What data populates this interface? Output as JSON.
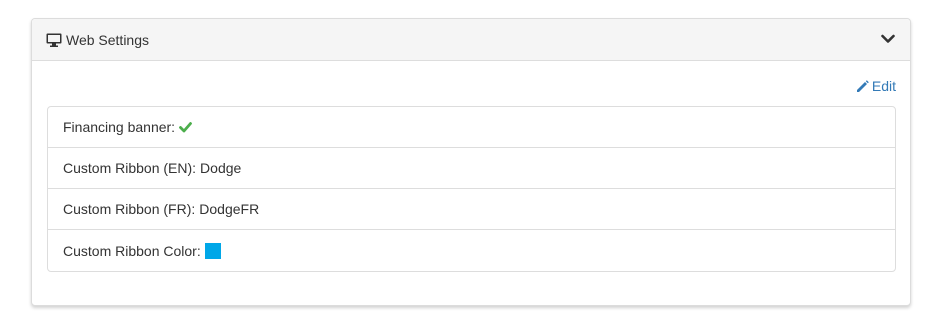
{
  "panel": {
    "title": "Web Settings",
    "title_icon": "monitor-icon",
    "toggle_icon": "chevron-down-icon",
    "edit_label": "Edit",
    "edit_icon": "pencil-icon"
  },
  "settings": [
    {
      "label": "Financing banner:",
      "value": "",
      "value_type": "check-icon"
    },
    {
      "label": "Custom Ribbon (EN):",
      "value": "Dodge",
      "value_type": "text"
    },
    {
      "label": "Custom Ribbon (FR):",
      "value": "DodgeFR",
      "value_type": "text"
    },
    {
      "label": "Custom Ribbon Color:",
      "value": "",
      "value_type": "color-swatch"
    }
  ],
  "colors": {
    "check": "#4cae4c",
    "ribbon_color": "#00a7e8",
    "link": "#337ab7"
  }
}
